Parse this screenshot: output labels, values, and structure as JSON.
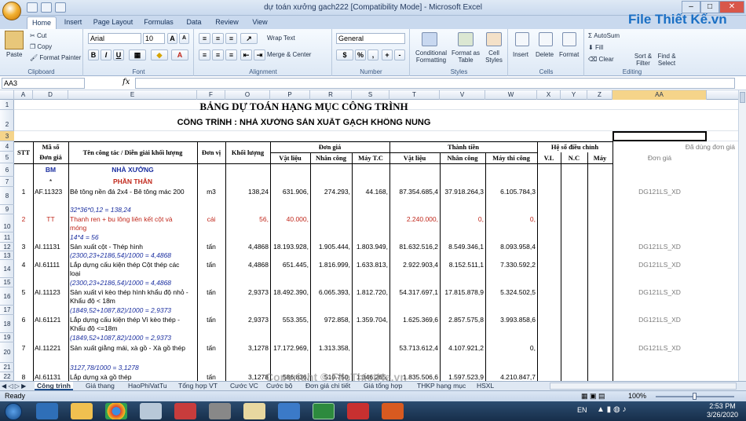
{
  "window": {
    "title": "dự toán xưởng gach222  [Compatibility Mode]  -  Microsoft Excel"
  },
  "ribbon_tabs": [
    "Home",
    "Insert",
    "Page Layout",
    "Formulas",
    "Data",
    "Review",
    "View"
  ],
  "ribbon": {
    "clipboard": {
      "paste": "Paste",
      "cut": "Cut",
      "copy": "Copy",
      "format_painter": "Format Painter",
      "label": "Clipboard"
    },
    "font": {
      "name": "Arial",
      "size": "10",
      "bold": "B",
      "italic": "I",
      "underline": "U",
      "label": "Font"
    },
    "alignment": {
      "wrap": "Wrap Text",
      "merge": "Merge & Center",
      "label": "Alignment"
    },
    "number": {
      "format": "General",
      "currency": "$",
      "percent": "%",
      "comma": ",",
      "label": "Number"
    },
    "styles": {
      "cond": "Conditional Formatting",
      "table": "Format as Table",
      "cell": "Cell Styles",
      "label": "Styles"
    },
    "cells": {
      "insert": "Insert",
      "delete": "Delete",
      "format": "Format",
      "label": "Cells"
    },
    "editing": {
      "autosum": "AutoSum",
      "fill": "Fill",
      "clear": "Clear",
      "sort": "Sort & Filter",
      "find": "Find & Select",
      "label": "Editing"
    }
  },
  "namebox": "AA3",
  "fx": "fx",
  "columns": [
    "A",
    "D",
    "E",
    "F",
    "O",
    "P",
    "R",
    "S",
    "T",
    "V",
    "W",
    "X",
    "Y",
    "Z",
    "AA"
  ],
  "rows": [
    "1",
    "2",
    "3",
    "4",
    "5",
    "6",
    "7",
    "8",
    "9",
    "10",
    "11",
    "12",
    "13",
    "14",
    "15",
    "16",
    "17",
    "18",
    "19",
    "20",
    "21",
    "22"
  ],
  "sheet": {
    "title": "BẢNG DỰ TOÁN HẠNG MỤC CÔNG TRÌNH",
    "subtitle": "CÔNG TRÌNH : NHÀ XƯỞNG SẢN XUẤT GẠCH KHÔNG NUNG",
    "headers": {
      "stt": "STT",
      "maso": "Mã số",
      "dongia_col": "Đơn giá",
      "tencv": "Tên công tác / Diễn giải khối lượng",
      "donvi": "Đơn vị",
      "khoiluong": "Khối lượng",
      "dongia": "Đơn giá",
      "thanhtien": "Thành tiền",
      "heso": "Hệ số điều chỉnh",
      "vatlieu": "Vật liệu",
      "nhancong": "Nhân công",
      "maytc": "Máy T.C",
      "vatlieu2": "Vật liệu",
      "nhancong2": "Nhân công",
      "maythicong": "Máy thi công",
      "vl": "V.L",
      "nc": "N.C",
      "may": "Máy",
      "dadung": "Đã dùng đơn giá",
      "dongia_aa": "Đơn giá"
    },
    "row6": {
      "code": "BM",
      "name": "NHÀ XƯỞNG"
    },
    "row7": {
      "code": "*",
      "name": "PHẦN THÂN"
    },
    "items": [
      {
        "stt": "1",
        "code": "AF.11323",
        "name": "Bê tông nền đá 2x4 - Bê tông mác 200",
        "unit": "m3",
        "qty": "138,24",
        "vl": "631.906,",
        "nc": "274.293,",
        "m": "44.168,",
        "tvl": "87.354.685,4",
        "tnc": "37.918.264,3",
        "tm": "6.105.784,3",
        "aa": "DG121LS_XD",
        "formula": "32*36*0,12 = 138,24"
      },
      {
        "stt": "2",
        "code": "TT",
        "name1": "Thanh ren + bu lông liên kết cột và",
        "name2": "móng",
        "unit": "cái",
        "qty": "56,",
        "vl": "40.000,",
        "tvl": "2.240.000,",
        "tnc": "0,",
        "tm": "0,",
        "formula": "14*4 = 56"
      },
      {
        "stt": "3",
        "code": "AI.11131",
        "name": "Sản xuất cột - Thép hình",
        "unit": "tấn",
        "qty": "4,4868",
        "vl": "18.193.928,",
        "nc": "1.905.444,",
        "m": "1.803.949,",
        "tvl": "81.632.516,2",
        "tnc": "8.549.346,1",
        "tm": "8.093.958,4",
        "aa": "DG121LS_XD",
        "formula": "(2300,23+2186,54)/1000 = 4,4868"
      },
      {
        "stt": "4",
        "code": "AI.61111",
        "name1": "Lắp dựng cấu kiện thép Cột thép các",
        "name2": "loại",
        "unit": "tấn",
        "qty": "4,4868",
        "vl": "651.445,",
        "nc": "1.816.999,",
        "m": "1.633.813,",
        "tvl": "2.922.903,4",
        "tnc": "8.152.511,1",
        "tm": "7.330.592,2",
        "aa": "DG121LS_XD",
        "formula": "(2300,23+2186,54)/1000 = 4,4868"
      },
      {
        "stt": "5",
        "code": "AI.11123",
        "name1": "Sản xuất vì kèo thép hình khẩu độ nhỏ -",
        "name2": "Khẩu độ < 18m",
        "unit": "tấn",
        "qty": "2,9373",
        "vl": "18.492.390,",
        "nc": "6.065.393,",
        "m": "1.812.720,",
        "tvl": "54.317.697,1",
        "tnc": "17.815.878,9",
        "tm": "5.324.502,5",
        "aa": "DG121LS_XD",
        "formula": "(1849,52+1087,82)/1000 = 2,9373"
      },
      {
        "stt": "6",
        "code": "AI.61121",
        "name1": "Lắp dựng cấu kiện thép Vì kèo thép -",
        "name2": "Khẩu độ <=18m",
        "unit": "tấn",
        "qty": "2,9373",
        "vl": "553.355,",
        "nc": "972.858,",
        "m": "1.359.704,",
        "tvl": "1.625.369,6",
        "tnc": "2.857.575,8",
        "tm": "3.993.858,6",
        "aa": "DG121LS_XD",
        "formula": "(1849,52+1087,82)/1000 = 2,9373"
      },
      {
        "stt": "7",
        "code": "AI.11221",
        "name1": "Sản xuất giằng mái, xà gồ - Xà gồ thép",
        "name2": "",
        "unit": "tấn",
        "qty": "3,1278",
        "vl": "17.172.969,",
        "nc": "1.313.358,",
        "m": "",
        "tvl": "53.713.612,4",
        "tnc": "4.107.921,2",
        "tm": "0,",
        "aa": "DG121LS_XD",
        "formula": "3127,78/1000 = 3,1278"
      },
      {
        "stt": "8",
        "code": "AI.61131",
        "name": "Lắp dựng xà gồ thép",
        "unit": "tấn",
        "qty": "3,1278",
        "vl": "586.836,",
        "nc": "510.750,",
        "m": "1.346.265,",
        "tvl": "1.835.506,6",
        "tnc": "1.597.523,9",
        "tm": "4.210.847,7"
      }
    ]
  },
  "sheet_tabs": [
    "Công trình",
    "Giá thang",
    "HaoPhiVatTu",
    "Tổng hợp VT",
    "Cước VC",
    "Cước bộ",
    "Đơn giá chi tiết",
    "Giá tổng hợp",
    "THKP hạng mục",
    "HSXL"
  ],
  "status": {
    "ready": "Ready",
    "zoom": "100%"
  },
  "taskbar": {
    "lang": "EN",
    "time": "2:53 PM",
    "date": "3/26/2020"
  },
  "watermark": {
    "logo": "File Thiết Kế.vn",
    "center": "Copyright © FileThietKe.vn"
  }
}
